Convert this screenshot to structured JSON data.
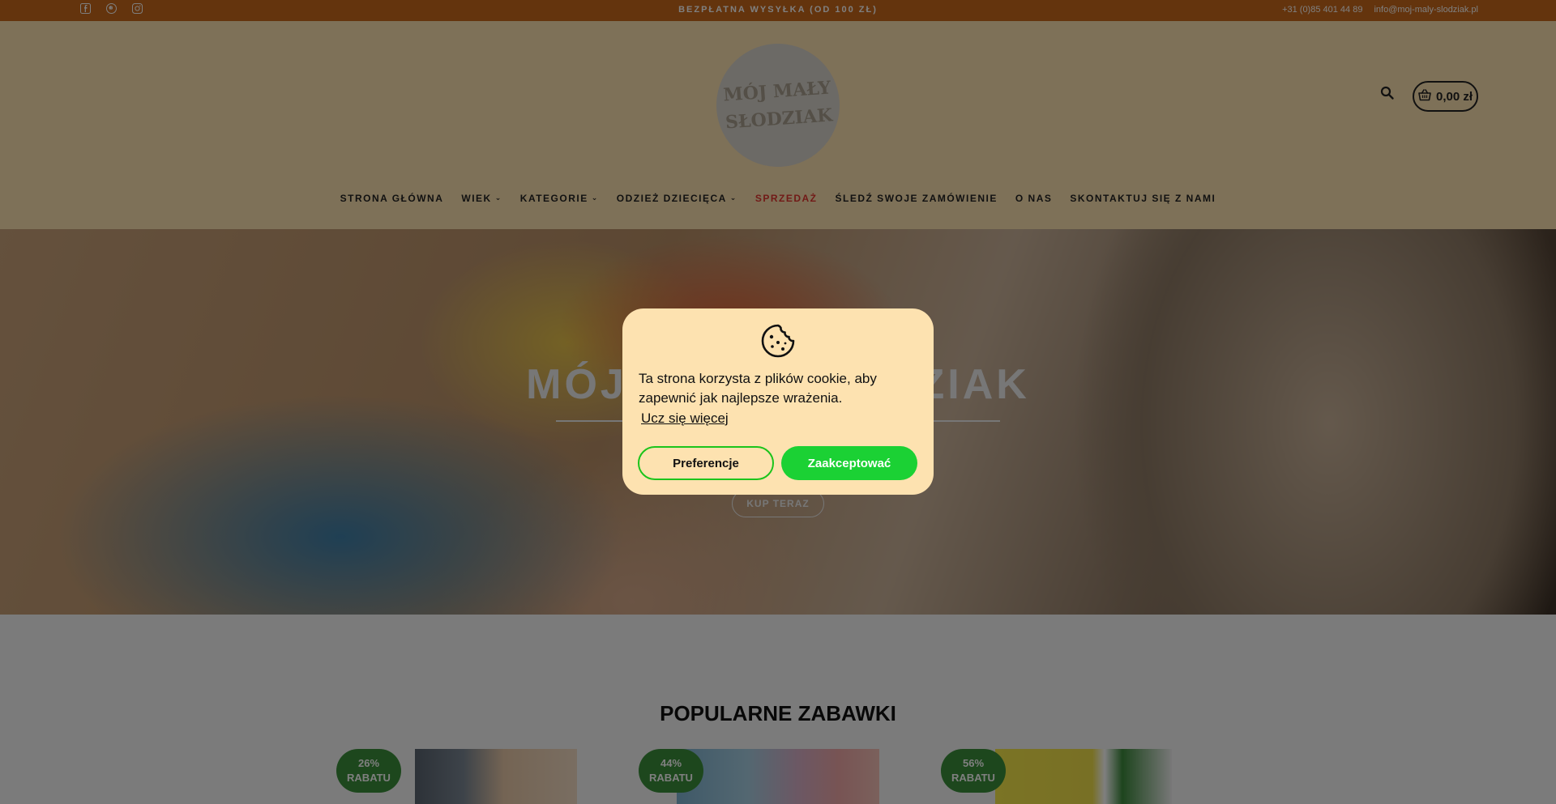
{
  "topbar": {
    "promo": "BEZPŁATNA WYSYŁKA (OD 100 ZŁ)",
    "phone": "+31 (0)85 401 44 89",
    "email": "info@moj-maly-slodziak.pl",
    "socials": [
      "facebook-icon",
      "pinterest-icon",
      "instagram-icon"
    ]
  },
  "header": {
    "logo_line1": "MÓJ MAŁY",
    "logo_line2": "SŁODZIAK",
    "cart_total": "0,00 zł"
  },
  "nav": {
    "items": [
      {
        "label": "STRONA GŁÓWNA",
        "dropdown": false
      },
      {
        "label": "WIEK",
        "dropdown": true
      },
      {
        "label": "KATEGORIE",
        "dropdown": true
      },
      {
        "label": "ODZIEŻ DZIECIĘCA",
        "dropdown": true
      },
      {
        "label": "SPRZEDAŻ",
        "dropdown": false,
        "color": "#e3342f"
      },
      {
        "label": "ŚLEDŹ SWOJE ZAMÓWIENIE",
        "dropdown": false
      },
      {
        "label": "O NAS",
        "dropdown": false
      },
      {
        "label": "SKONTAKTUJ SIĘ Z NAMI",
        "dropdown": false
      }
    ]
  },
  "hero": {
    "title": "MÓJ MAŁY SŁODZIAK",
    "button": "KUP TERAZ"
  },
  "products": {
    "section_title": "POPULARNE ZABAWKI",
    "items": [
      {
        "badge_percent": "26%",
        "badge_label": "RABATU"
      },
      {
        "badge_percent": "44%",
        "badge_label": "RABATU"
      },
      {
        "badge_percent": "56%",
        "badge_label": "RABATU"
      }
    ]
  },
  "cookie": {
    "message": "Ta strona korzysta z plików cookie, aby zapewnić jak najlepsze wrażenia.",
    "learn_more": "Ucz się więcej",
    "preferences": "Preferencje",
    "accept": "Zaakceptować"
  },
  "colors": {
    "topbar": "#c8691a",
    "header_bg": "#fde2b0",
    "sale": "#e3342f",
    "accept": "#1bd134",
    "badge": "#3a8f3a"
  }
}
